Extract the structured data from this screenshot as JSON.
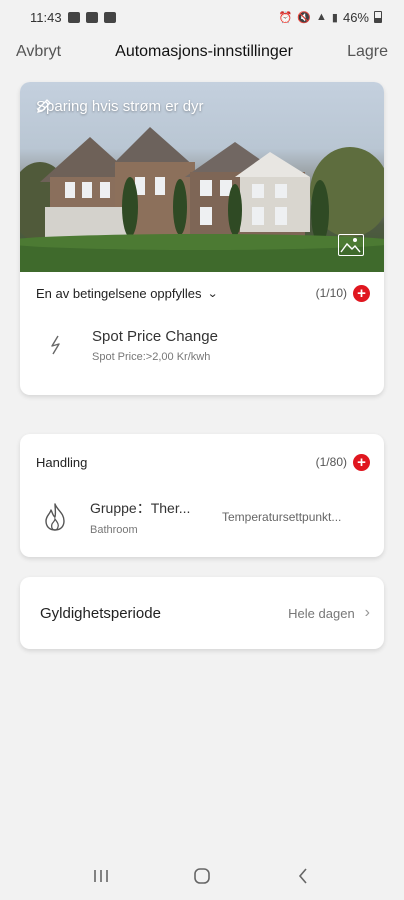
{
  "status_bar": {
    "time": "11:43",
    "battery": "46%"
  },
  "header": {
    "cancel_label": "Avbryt",
    "title": "Automasjons-innstillinger",
    "save_label": "Lagre"
  },
  "scene": {
    "name": "Sparing hvis strøm er dyr",
    "condition_mode": "En av betingelsene oppfylles",
    "condition_count": "(1/10)",
    "trigger": {
      "title": "Spot Price Change",
      "subtitle": "Spot Price:>2,00 Kr/kwh",
      "icon": "lightning-icon"
    }
  },
  "action": {
    "title": "Handling",
    "count": "(1/80)",
    "item": {
      "title": "Gruppe：Ther...",
      "subtitle": "Bathroom",
      "value": "Temperatursettpunkt...",
      "icon": "flame-icon"
    }
  },
  "validity": {
    "label": "Gyldighetsperiode",
    "value": "Hele dagen"
  },
  "colors": {
    "accent_red": "#e0161f",
    "background": "#f2f2f2"
  }
}
